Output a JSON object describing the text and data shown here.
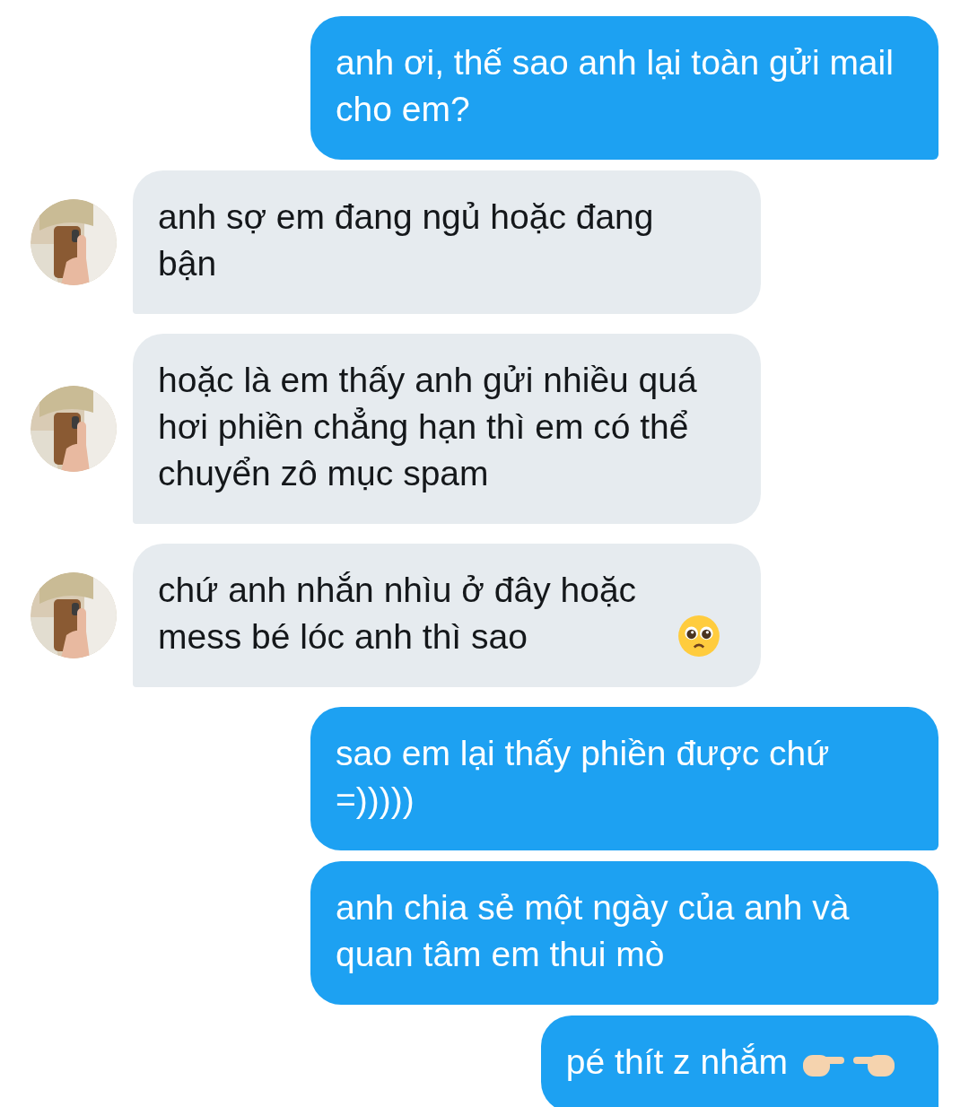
{
  "messages": [
    {
      "kind": "sent",
      "text": "anh ơi, thế sao anh lại toàn gửi mail cho em?"
    },
    {
      "kind": "received",
      "text": "anh sợ em đang ngủ hoặc đang bận"
    },
    {
      "kind": "received",
      "text": "hoặc là em thấy anh gửi nhiều quá hơi phiền chẳng hạn thì em có thể chuyển zô mục spam"
    },
    {
      "kind": "received",
      "text": "chứ anh nhắn nhìu ở đây hoặc mess bé lóc anh thì sao"
    },
    {
      "kind": "sent",
      "text": "sao em lại thấy phiền được chứ =)))))"
    },
    {
      "kind": "sent",
      "text": "anh chia sẻ một ngày của anh và quan tâm em thui mò"
    },
    {
      "kind": "sent",
      "text": "pé thít z nhắm"
    }
  ]
}
